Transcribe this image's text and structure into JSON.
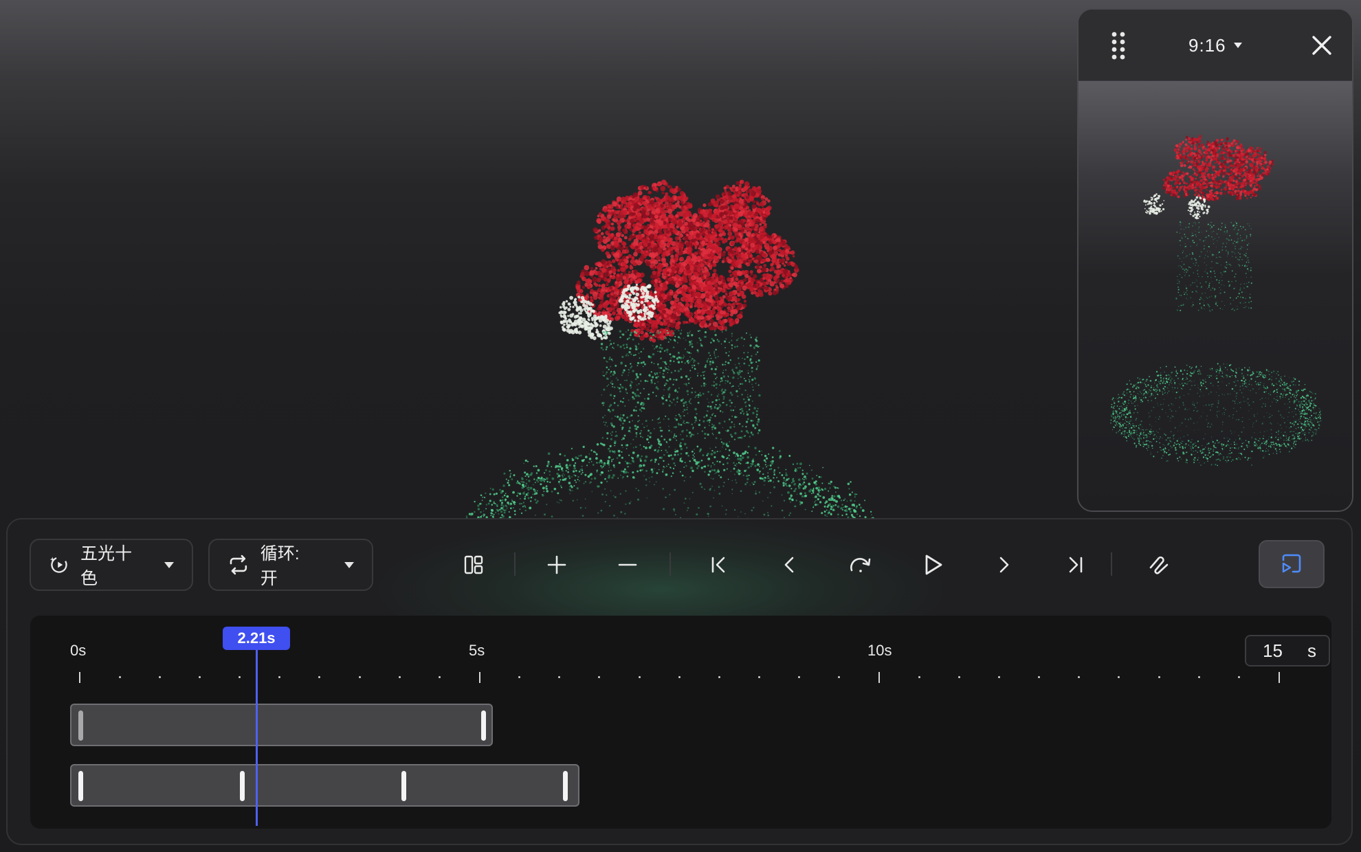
{
  "preview": {
    "aspect_ratio": "9:16"
  },
  "toolbar": {
    "effect_label": "五光十色",
    "loop_label": "循环: 开"
  },
  "timeline": {
    "labels": [
      "0s",
      "5s",
      "10s"
    ],
    "playhead_time": "2.21s",
    "playhead_seconds": 2.21,
    "duration_value": "15",
    "duration_unit": "s",
    "track1": {
      "start_seconds": 0,
      "end_seconds": 5.25
    },
    "track2": {
      "start_seconds": 0,
      "end_seconds": 6.25,
      "keyframes_seconds": [
        0,
        2,
        4,
        6
      ]
    }
  },
  "colors": {
    "accent": "#3f4ff0",
    "flower_red": "#c81e2e",
    "point_green": "#46c07f"
  },
  "icons": {
    "effect": "sparkle-icon",
    "loop": "repeat-icon",
    "layout": "layout-icon",
    "zoom_in": "plus-icon",
    "zoom_out": "minus-icon",
    "first": "skip-first-icon",
    "prev": "chevron-left-icon",
    "replay": "redo-icon",
    "play": "play-icon",
    "next": "chevron-right-icon",
    "last": "skip-last-icon",
    "path": "path-icon",
    "cast": "cast-icon",
    "drag": "drag-handle-icon",
    "close": "close-icon"
  }
}
